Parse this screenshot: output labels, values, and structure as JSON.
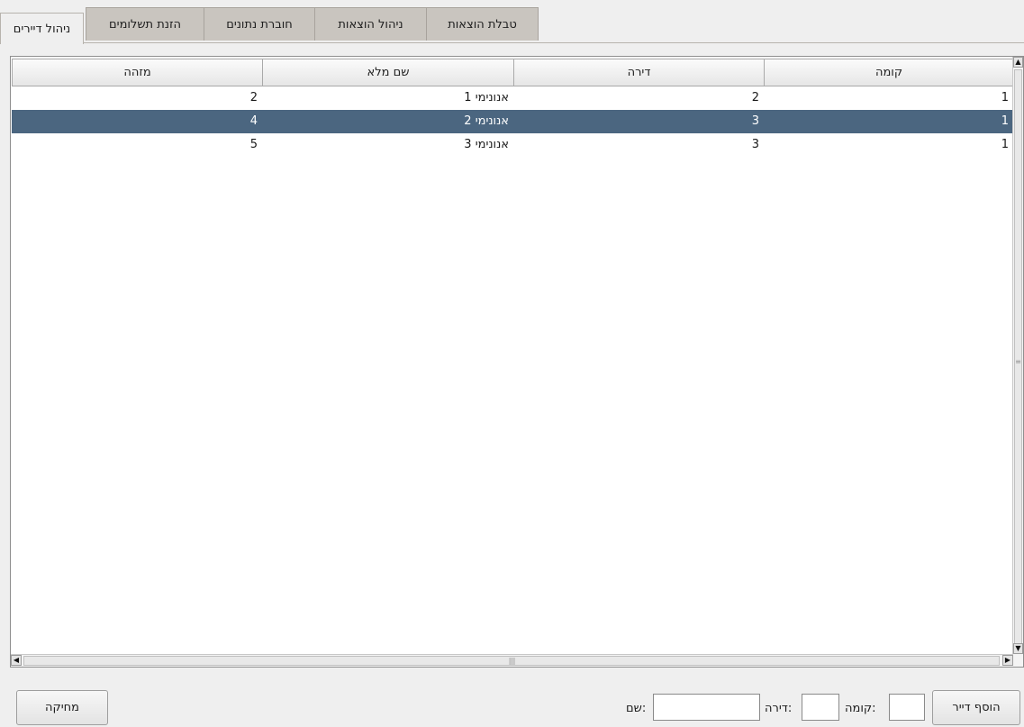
{
  "tabs": [
    {
      "label": "טבלת הוצאות"
    },
    {
      "label": "ניהול הוצאות"
    },
    {
      "label": "חוברת נתונים"
    },
    {
      "label": "הזנת תשלומים"
    },
    {
      "label": "ניהול דיירים"
    }
  ],
  "active_tab": "ניהול דיירים",
  "table": {
    "columns": [
      "קומה",
      "דירה",
      "שם מלא",
      "מזהה"
    ],
    "rows": [
      {
        "floor": "1",
        "apartment": "2",
        "name": "אנונימי 1",
        "id": "2"
      },
      {
        "floor": "1",
        "apartment": "3",
        "name": "אנונימי 2",
        "id": "4"
      },
      {
        "floor": "1",
        "apartment": "3",
        "name": "אנונימי 3",
        "id": "5"
      }
    ],
    "selected_row_index": 1
  },
  "form": {
    "add_button": "הוסף דייר",
    "floor_label": "קומה:",
    "floor_value": "",
    "apartment_label": "דירה:",
    "apartment_value": "",
    "name_label": "שם:",
    "name_value": "",
    "delete_button": "מחיקה"
  },
  "colors": {
    "selected_row": "#4b6680",
    "tab_inactive": "#c9c5bf",
    "background": "#efefef"
  }
}
